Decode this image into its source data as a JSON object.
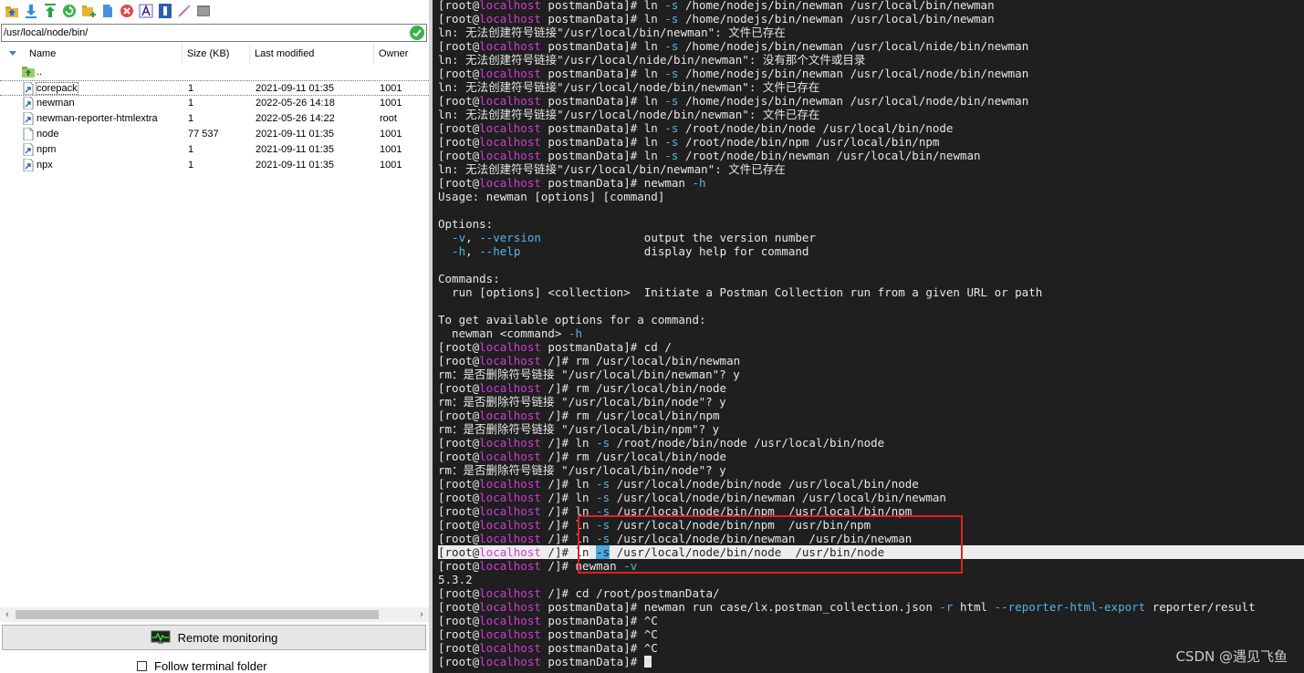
{
  "toolbar": {
    "icons": [
      "go-up-icon",
      "download-icon",
      "upload-icon",
      "refresh-icon",
      "new-folder-icon",
      "new-file-icon",
      "delete-icon",
      "rename-icon",
      "properties-icon",
      "edit-icon",
      "terminal-icon"
    ]
  },
  "path": {
    "value": "/usr/local/node/bin/"
  },
  "columns": {
    "name": "Name",
    "size": "Size (KB)",
    "modified": "Last modified",
    "owner": "Owner"
  },
  "files": [
    {
      "name": "..",
      "size": "",
      "modified": "",
      "owner": "",
      "kind": "parent"
    },
    {
      "name": "corepack",
      "size": "1",
      "modified": "2021-09-11 01:35",
      "owner": "1001",
      "kind": "link",
      "selected": true
    },
    {
      "name": "newman",
      "size": "1",
      "modified": "2022-05-26 14:18",
      "owner": "1001",
      "kind": "link"
    },
    {
      "name": "newman-reporter-htmlextra",
      "size": "1",
      "modified": "2022-05-26 14:22",
      "owner": "root",
      "kind": "link"
    },
    {
      "name": "node",
      "size": "77 537",
      "modified": "2021-09-11 01:35",
      "owner": "1001",
      "kind": "file"
    },
    {
      "name": "npm",
      "size": "1",
      "modified": "2021-09-11 01:35",
      "owner": "1001",
      "kind": "link"
    },
    {
      "name": "npx",
      "size": "1",
      "modified": "2021-09-11 01:35",
      "owner": "1001",
      "kind": "link"
    }
  ],
  "remote_monitoring": {
    "label": "Remote monitoring"
  },
  "follow_terminal": {
    "label": "Follow terminal folder",
    "checked": false
  },
  "terminal": {
    "lines": [
      [
        [
          "p",
          "[root@"
        ],
        [
          "h",
          "localhost"
        ],
        [
          "p",
          " postmanData]# ln "
        ],
        [
          "f",
          "-s"
        ],
        [
          "p",
          " /home/nodejs/bin/newman /usr/local/bin/newman"
        ]
      ],
      [
        [
          "p",
          "[root@"
        ],
        [
          "h",
          "localhost"
        ],
        [
          "p",
          " postmanData]# ln "
        ],
        [
          "f",
          "-s"
        ],
        [
          "p",
          " /home/nodejs/bin/newman /usr/local/bin/newman"
        ]
      ],
      [
        [
          "p",
          "ln: 无法创建符号链接\"/usr/local/bin/newman\": 文件已存在"
        ]
      ],
      [
        [
          "p",
          "[root@"
        ],
        [
          "h",
          "localhost"
        ],
        [
          "p",
          " postmanData]# ln "
        ],
        [
          "f",
          "-s"
        ],
        [
          "p",
          " /home/nodejs/bin/newman /usr/local/nide/bin/newman"
        ]
      ],
      [
        [
          "p",
          "ln: 无法创建符号链接\"/usr/local/nide/bin/newman\": 没有那个文件或目录"
        ]
      ],
      [
        [
          "p",
          "[root@"
        ],
        [
          "h",
          "localhost"
        ],
        [
          "p",
          " postmanData]# ln "
        ],
        [
          "f",
          "-s"
        ],
        [
          "p",
          " /home/nodejs/bin/newman /usr/local/node/bin/newman"
        ]
      ],
      [
        [
          "p",
          "ln: 无法创建符号链接\"/usr/local/node/bin/newman\": 文件已存在"
        ]
      ],
      [
        [
          "p",
          "[root@"
        ],
        [
          "h",
          "localhost"
        ],
        [
          "p",
          " postmanData]# ln "
        ],
        [
          "f",
          "-s"
        ],
        [
          "p",
          " /home/nodejs/bin/newman /usr/local/node/bin/newman"
        ]
      ],
      [
        [
          "p",
          "ln: 无法创建符号链接\"/usr/local/node/bin/newman\": 文件已存在"
        ]
      ],
      [
        [
          "p",
          "[root@"
        ],
        [
          "h",
          "localhost"
        ],
        [
          "p",
          " postmanData]# ln "
        ],
        [
          "f",
          "-s"
        ],
        [
          "p",
          " /root/node/bin/node /usr/local/bin/node"
        ]
      ],
      [
        [
          "p",
          "[root@"
        ],
        [
          "h",
          "localhost"
        ],
        [
          "p",
          " postmanData]# ln "
        ],
        [
          "f",
          "-s"
        ],
        [
          "p",
          " /root/node/bin/npm /usr/local/bin/npm"
        ]
      ],
      [
        [
          "p",
          "[root@"
        ],
        [
          "h",
          "localhost"
        ],
        [
          "p",
          " postmanData]# ln "
        ],
        [
          "f",
          "-s"
        ],
        [
          "p",
          " /root/node/bin/newman /usr/local/bin/newman"
        ]
      ],
      [
        [
          "p",
          "ln: 无法创建符号链接\"/usr/local/bin/newman\": 文件已存在"
        ]
      ],
      [
        [
          "p",
          "[root@"
        ],
        [
          "h",
          "localhost"
        ],
        [
          "p",
          " postmanData]# newman "
        ],
        [
          "f",
          "-h"
        ]
      ],
      [
        [
          "p",
          "Usage: newman [options] [command]"
        ]
      ],
      [
        [
          "p",
          ""
        ]
      ],
      [
        [
          "p",
          "Options:"
        ]
      ],
      [
        [
          "p",
          "  "
        ],
        [
          "f",
          "-v"
        ],
        [
          "p",
          ", "
        ],
        [
          "f",
          "--version"
        ],
        [
          "p",
          "               output the version number"
        ]
      ],
      [
        [
          "p",
          "  "
        ],
        [
          "f",
          "-h"
        ],
        [
          "p",
          ", "
        ],
        [
          "f",
          "--help"
        ],
        [
          "p",
          "                  display help for command"
        ]
      ],
      [
        [
          "p",
          ""
        ]
      ],
      [
        [
          "p",
          "Commands:"
        ]
      ],
      [
        [
          "p",
          "  run [options] <collection>  Initiate a Postman Collection run from a given URL or path"
        ]
      ],
      [
        [
          "p",
          ""
        ]
      ],
      [
        [
          "p",
          "To get available options for a command:"
        ]
      ],
      [
        [
          "p",
          "  newman <command> "
        ],
        [
          "f",
          "-h"
        ]
      ],
      [
        [
          "p",
          "[root@"
        ],
        [
          "h",
          "localhost"
        ],
        [
          "p",
          " postmanData]# cd /"
        ]
      ],
      [
        [
          "p",
          "[root@"
        ],
        [
          "h",
          "localhost"
        ],
        [
          "p",
          " /]# rm /usr/local/bin/newman"
        ]
      ],
      [
        [
          "p",
          "rm：是否删除符号链接 \"/usr/local/bin/newman\"? y"
        ]
      ],
      [
        [
          "p",
          "[root@"
        ],
        [
          "h",
          "localhost"
        ],
        [
          "p",
          " /]# rm /usr/local/bin/node"
        ]
      ],
      [
        [
          "p",
          "rm：是否删除符号链接 \"/usr/local/bin/node\"? y"
        ]
      ],
      [
        [
          "p",
          "[root@"
        ],
        [
          "h",
          "localhost"
        ],
        [
          "p",
          " /]# rm /usr/local/bin/npm"
        ]
      ],
      [
        [
          "p",
          "rm：是否删除符号链接 \"/usr/local/bin/npm\"? y"
        ]
      ],
      [
        [
          "p",
          "[root@"
        ],
        [
          "h",
          "localhost"
        ],
        [
          "p",
          " /]# ln "
        ],
        [
          "f",
          "-s"
        ],
        [
          "p",
          " /root/node/bin/node /usr/local/bin/node"
        ]
      ],
      [
        [
          "p",
          "[root@"
        ],
        [
          "h",
          "localhost"
        ],
        [
          "p",
          " /]# rm /usr/local/bin/node"
        ]
      ],
      [
        [
          "p",
          "rm：是否删除符号链接 \"/usr/local/bin/node\"? y"
        ]
      ],
      [
        [
          "p",
          "[root@"
        ],
        [
          "h",
          "localhost"
        ],
        [
          "p",
          " /]# ln "
        ],
        [
          "f",
          "-s"
        ],
        [
          "p",
          " /usr/local/node/bin/node /usr/local/bin/node"
        ]
      ],
      [
        [
          "p",
          "[root@"
        ],
        [
          "h",
          "localhost"
        ],
        [
          "p",
          " /]# ln "
        ],
        [
          "f",
          "-s"
        ],
        [
          "p",
          " /usr/local/node/bin/newman /usr/local/bin/newman"
        ]
      ],
      [
        [
          "p",
          "[root@"
        ],
        [
          "h",
          "localhost"
        ],
        [
          "p",
          " /]# ln "
        ],
        [
          "f",
          "-s"
        ],
        [
          "p",
          " /usr/local/node/bin/npm  /usr/local/bin/npm"
        ]
      ],
      [
        [
          "p",
          "[root@"
        ],
        [
          "h",
          "localhost"
        ],
        [
          "p",
          " /]# ln "
        ],
        [
          "f",
          "-s"
        ],
        [
          "p",
          " /usr/local/node/bin/npm  /usr/bin/npm"
        ]
      ],
      [
        [
          "p",
          "[root@"
        ],
        [
          "h",
          "localhost"
        ],
        [
          "p",
          " /]# ln "
        ],
        [
          "f",
          "-s"
        ],
        [
          "p",
          " /usr/local/node/bin/newman  /usr/bin/newman"
        ]
      ],
      [
        [
          "p",
          "[root@"
        ],
        [
          "h",
          "localhost"
        ],
        [
          "p",
          " /]# "
        ],
        [
          "L",
          "ln"
        ],
        [
          "p",
          " "
        ],
        [
          "F",
          "-s"
        ],
        [
          "p",
          " /usr/local/node/bin/node  /usr/bin/node"
        ]
      ],
      [
        [
          "p",
          "[root@"
        ],
        [
          "h",
          "localhost"
        ],
        [
          "p",
          " /]# newman "
        ],
        [
          "f",
          "-v"
        ]
      ],
      [
        [
          "p",
          "5.3.2"
        ]
      ],
      [
        [
          "p",
          "[root@"
        ],
        [
          "h",
          "localhost"
        ],
        [
          "p",
          " /]# cd /root/postmanData/"
        ]
      ],
      [
        [
          "p",
          "[root@"
        ],
        [
          "h",
          "localhost"
        ],
        [
          "p",
          " postmanData]# newman run case/lx.postman_collection.json "
        ],
        [
          "f",
          "-r"
        ],
        [
          "p",
          " html "
        ],
        [
          "f",
          "--reporter-html-export"
        ],
        [
          "p",
          " reporter/result"
        ]
      ],
      [
        [
          "p",
          "[root@"
        ],
        [
          "h",
          "localhost"
        ],
        [
          "p",
          " postmanData]# ^C"
        ]
      ],
      [
        [
          "p",
          "[root@"
        ],
        [
          "h",
          "localhost"
        ],
        [
          "p",
          " postmanData]# ^C"
        ]
      ],
      [
        [
          "p",
          "[root@"
        ],
        [
          "h",
          "localhost"
        ],
        [
          "p",
          " postmanData]# ^C"
        ]
      ],
      [
        [
          "p",
          "[root@"
        ],
        [
          "h",
          "localhost"
        ],
        [
          "p",
          " postmanData]# "
        ],
        [
          "c",
          ""
        ]
      ]
    ],
    "highlighted_line": 40
  },
  "watermark": "CSDN @遇见飞鱼"
}
